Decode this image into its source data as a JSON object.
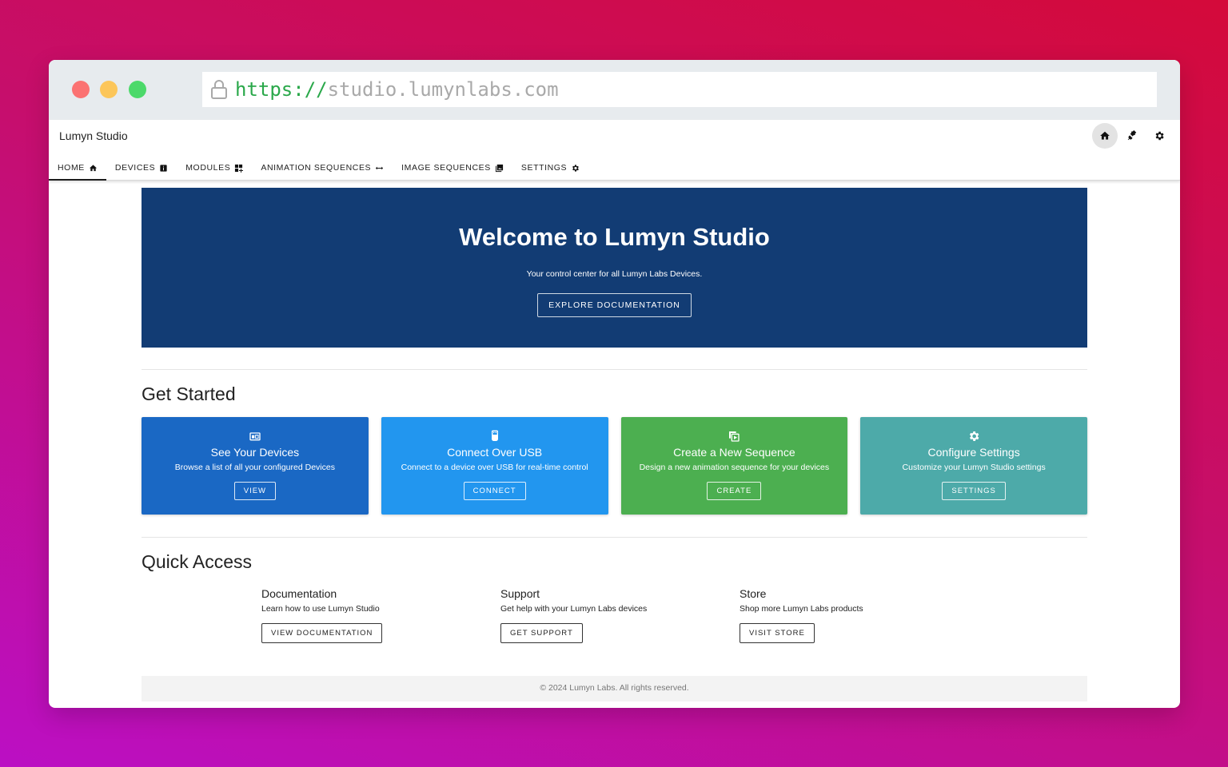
{
  "browser": {
    "url_scheme": "https://",
    "url_host": "studio.lumynlabs.com",
    "dots": [
      "#fb7272",
      "#fcc65a",
      "#4cd96a"
    ]
  },
  "app": {
    "title": "Lumyn Studio",
    "tabs": [
      {
        "label": "HOME",
        "icon": "home-icon",
        "active": true
      },
      {
        "label": "DEVICES",
        "icon": "device-info-icon"
      },
      {
        "label": "MODULES",
        "icon": "modules-icon"
      },
      {
        "label": "ANIMATION SEQUENCES",
        "icon": "arrows-horizontal-icon"
      },
      {
        "label": "IMAGE SEQUENCES",
        "icon": "image-stack-icon"
      },
      {
        "label": "SETTINGS",
        "icon": "gear-icon"
      }
    ],
    "top_icons": [
      "home-icon",
      "usb-connect-icon",
      "gear-icon"
    ]
  },
  "hero": {
    "title": "Welcome to Lumyn Studio",
    "subtitle": "Your control center for all Lumyn Labs Devices.",
    "button": "EXPLORE DOCUMENTATION",
    "bg": "#123c74"
  },
  "get_started": {
    "title": "Get Started",
    "cards": [
      {
        "title": "See Your Devices",
        "desc": "Browse a list of all your configured Devices",
        "button": "VIEW",
        "color": "#1a68c4",
        "icon": "devices-icon"
      },
      {
        "title": "Connect Over USB",
        "desc": "Connect to a device over USB for real-time control",
        "button": "CONNECT",
        "color": "#2296ef",
        "icon": "usb-icon"
      },
      {
        "title": "Create a New Sequence",
        "desc": "Design a new animation sequence for your devices",
        "button": "CREATE",
        "color": "#4caf50",
        "icon": "sequence-icon"
      },
      {
        "title": "Configure Settings",
        "desc": "Customize your Lumyn Studio settings",
        "button": "SETTINGS",
        "color": "#4daaa9",
        "icon": "gear-icon"
      }
    ]
  },
  "quick_access": {
    "title": "Quick Access",
    "items": [
      {
        "title": "Documentation",
        "desc": "Learn how to use Lumyn Studio",
        "button": "VIEW DOCUMENTATION"
      },
      {
        "title": "Support",
        "desc": "Get help with your Lumyn Labs devices",
        "button": "GET SUPPORT"
      },
      {
        "title": "Store",
        "desc": "Shop more Lumyn Labs products",
        "button": "VISIT STORE"
      }
    ]
  },
  "footer": {
    "text": "© 2024 Lumyn Labs. All rights reserved."
  }
}
